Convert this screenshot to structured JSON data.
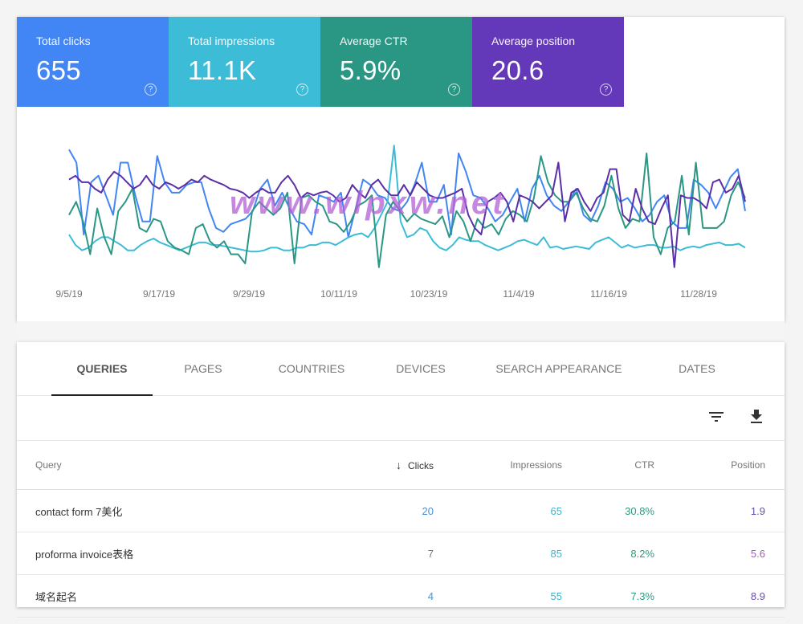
{
  "metrics": [
    {
      "label": "Total clicks",
      "value": "655",
      "color": "#4285f4",
      "help_icon": "help-circle-icon"
    },
    {
      "label": "Total impressions",
      "value": "11.1K",
      "color": "#3cbcd6",
      "help_icon": "help-circle-icon"
    },
    {
      "label": "Average CTR",
      "value": "5.9%",
      "color": "#2a9784",
      "help_icon": "help-circle-icon"
    },
    {
      "label": "Average position",
      "value": "20.6",
      "color": "#6439b9",
      "help_icon": "help-circle-icon"
    }
  ],
  "watermark": "www.wlpxw.net",
  "chart_data": {
    "type": "line",
    "title": "",
    "xlabel": "",
    "ylabel": "",
    "x_tick_labels": [
      "9/5/19",
      "9/17/19",
      "9/29/19",
      "10/11/19",
      "10/23/19",
      "11/4/19",
      "11/16/19",
      "11/28/19"
    ],
    "x_range": [
      "9/5/19",
      "12/5/19"
    ],
    "y_range_normalized": [
      0,
      100
    ],
    "grid": false,
    "legend": "none",
    "series": [
      {
        "name": "Clicks",
        "color": "#4285f4",
        "values": [
          95,
          85,
          30,
          70,
          75,
          60,
          45,
          85,
          85,
          60,
          40,
          40,
          90,
          70,
          62,
          62,
          68,
          70,
          70,
          50,
          35,
          32,
          38,
          40,
          42,
          48,
          65,
          72,
          52,
          62,
          50,
          40,
          38,
          30,
          60,
          58,
          55,
          62,
          28,
          50,
          72,
          68,
          60,
          58,
          50,
          48,
          55,
          68,
          85,
          55,
          55,
          68,
          30,
          92,
          78,
          60,
          58,
          50,
          40,
          45,
          55,
          65,
          40,
          65,
          75,
          60,
          52,
          48,
          55,
          65,
          45,
          40,
          52,
          70,
          65,
          55,
          58,
          50,
          40,
          45,
          55,
          60,
          40,
          35,
          35,
          72,
          68,
          62,
          50,
          62,
          74,
          80,
          48
        ]
      },
      {
        "name": "Impressions",
        "color": "#3cbcd6",
        "values": [
          30,
          22,
          18,
          20,
          25,
          28,
          28,
          25,
          22,
          18,
          18,
          22,
          25,
          27,
          24,
          22,
          20,
          18,
          20,
          22,
          24,
          24,
          22,
          22,
          21,
          20,
          19,
          18,
          17,
          17,
          18,
          20,
          20,
          18,
          18,
          20,
          20,
          22,
          22,
          24,
          24,
          22,
          25,
          28,
          30,
          31,
          28,
          35,
          45,
          55,
          98,
          40,
          28,
          30,
          35,
          33,
          25,
          20,
          18,
          22,
          28,
          26,
          25,
          25,
          22,
          20,
          18,
          20,
          22,
          25,
          26,
          24,
          22,
          28,
          20,
          21,
          19,
          20,
          21,
          20,
          19,
          24,
          26,
          28,
          24,
          20,
          22,
          20,
          21,
          22,
          22,
          20,
          20,
          21,
          18,
          20,
          21,
          20,
          22,
          23,
          24,
          22,
          22,
          23,
          20
        ]
      },
      {
        "name": "CTR",
        "color": "#2a9784",
        "values": [
          45,
          55,
          40,
          15,
          50,
          28,
          15,
          48,
          55,
          65,
          35,
          32,
          42,
          40,
          25,
          20,
          18,
          15,
          35,
          38,
          25,
          20,
          25,
          15,
          15,
          8,
          48,
          55,
          50,
          45,
          50,
          62,
          8,
          58,
          60,
          55,
          52,
          40,
          38,
          32,
          40,
          52,
          55,
          60,
          5,
          45,
          55,
          48,
          40,
          46,
          42,
          40,
          38,
          44,
          28,
          48,
          40,
          25,
          42,
          35,
          38,
          30,
          42,
          48,
          45,
          40,
          58,
          90,
          70,
          60,
          55,
          55,
          62,
          50,
          42,
          40,
          52,
          75,
          50,
          35,
          42,
          40,
          92,
          28,
          15,
          35,
          40,
          75,
          30,
          85,
          35,
          35,
          35,
          40,
          60,
          70,
          58
        ]
      },
      {
        "name": "Position",
        "color": "#5b2fa8",
        "values": [
          72,
          75,
          70,
          70,
          65,
          62,
          72,
          78,
          75,
          70,
          65,
          68,
          75,
          68,
          65,
          70,
          68,
          65,
          68,
          72,
          70,
          75,
          72,
          70,
          68,
          65,
          64,
          62,
          58,
          62,
          65,
          62,
          62,
          70,
          75,
          68,
          58,
          62,
          60,
          62,
          63,
          60,
          55,
          58,
          68,
          62,
          58,
          68,
          72,
          65,
          60,
          60,
          68,
          60,
          70,
          65,
          60,
          58,
          58,
          60,
          62,
          65,
          45,
          35,
          30,
          55,
          58,
          62,
          55,
          40,
          60,
          58,
          55,
          50,
          55,
          60,
          85,
          40,
          62,
          65,
          55,
          48,
          58,
          62,
          80,
          80,
          45,
          40,
          65,
          50,
          40,
          38,
          50,
          60,
          5,
          60,
          58,
          58,
          55,
          50,
          70,
          72,
          62,
          65,
          75,
          55
        ]
      }
    ]
  },
  "tabs": [
    {
      "label": "QUERIES",
      "active": true
    },
    {
      "label": "PAGES"
    },
    {
      "label": "COUNTRIES"
    },
    {
      "label": "DEVICES"
    },
    {
      "label": "SEARCH APPEARANCE"
    },
    {
      "label": "DATES"
    }
  ],
  "toolbar": {
    "filter_icon": "filter-icon",
    "download_icon": "download-icon"
  },
  "table": {
    "columns": {
      "query": "Query",
      "clicks": "Clicks",
      "impressions": "Impressions",
      "ctr": "CTR",
      "position": "Position"
    },
    "sort_icon": "arrow-down-icon",
    "rows": [
      {
        "query": "contact form 7美化",
        "clicks": "20",
        "impressions": "65",
        "ctr": "30.8%",
        "position": "1.9"
      },
      {
        "query": "proforma invoice表格",
        "clicks": "7",
        "impressions": "85",
        "ctr": "8.2%",
        "position": "5.6"
      },
      {
        "query": "域名起名",
        "clicks": "4",
        "impressions": "55",
        "ctr": "7.3%",
        "position": "8.9"
      }
    ]
  }
}
